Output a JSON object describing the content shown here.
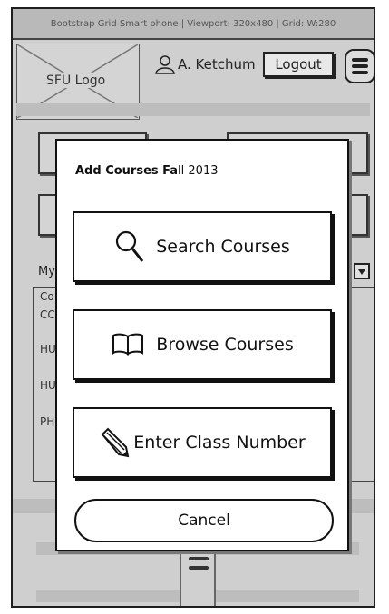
{
  "window": {
    "title": "Bootstrap Grid Smart phone  |  Viewport: 320x480  |  Grid: W:280"
  },
  "header": {
    "logo_label": "SFU Logo",
    "user_name": "A. Ketchum",
    "logout_label": "Logout",
    "menu_icon": "hamburger-menu-icon"
  },
  "background": {
    "section_label": "My",
    "course_rows": [
      "Co",
      "CC",
      "HU",
      "HU",
      "PH"
    ]
  },
  "modal": {
    "title_bold": "Add Courses Fa",
    "title_rest": "ll 2013",
    "buttons": [
      {
        "icon": "search-icon",
        "label": "Search Courses"
      },
      {
        "icon": "book-icon",
        "label": "Browse Courses"
      },
      {
        "icon": "pencil-icon",
        "label": "Enter Class Number"
      }
    ],
    "cancel_label": "Cancel"
  }
}
